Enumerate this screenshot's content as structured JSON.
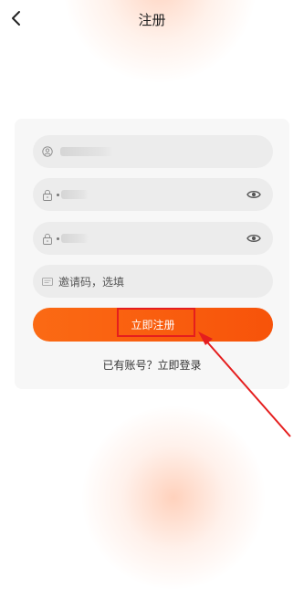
{
  "header": {
    "title": "注册",
    "back_icon": "chevron-left-icon"
  },
  "form": {
    "username": {
      "icon": "user-icon",
      "value_masked": true
    },
    "password": {
      "icon": "lock-icon",
      "toggle_icon": "eye-icon",
      "value_masked": true
    },
    "confirm_password": {
      "icon": "lock-icon",
      "toggle_icon": "eye-icon",
      "value_masked": true
    },
    "invite_code": {
      "icon": "abc-icon",
      "placeholder": "邀请码，选填"
    },
    "submit_label": "立即注册"
  },
  "footer": {
    "prompt": "已有账号？",
    "login_link": "立即登录"
  },
  "colors": {
    "accent": "#f7530a",
    "annotation": "#e51e1e",
    "card_bg": "#f7f7f7",
    "field_bg": "#ececec"
  }
}
